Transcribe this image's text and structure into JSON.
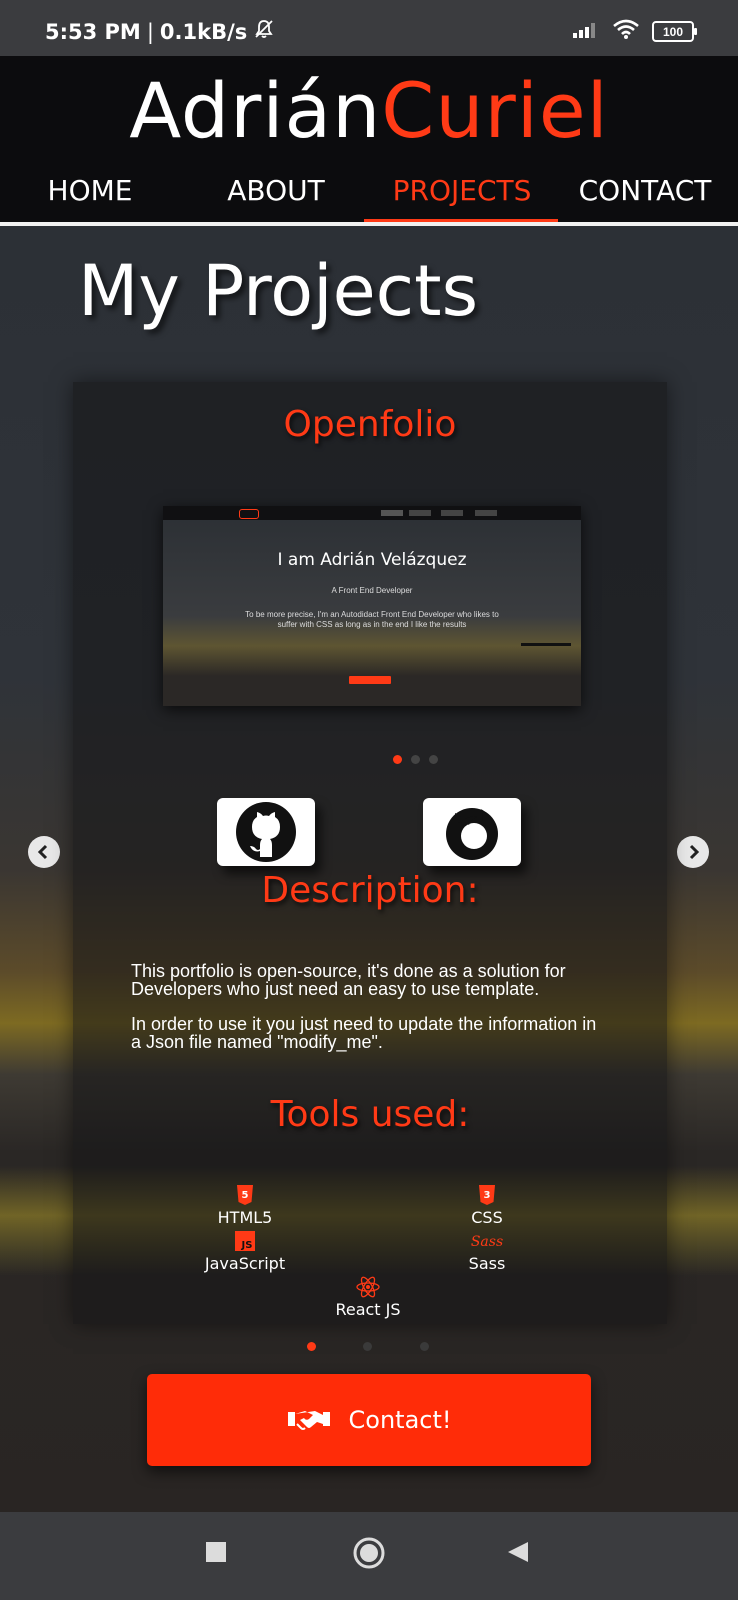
{
  "status_bar": {
    "time": "5:53 PM",
    "separator": "|",
    "net_speed": "0.1kB/s",
    "battery": "100",
    "icons": [
      "mute-bell-icon",
      "signal-icon",
      "wifi-icon",
      "battery-icon"
    ]
  },
  "header": {
    "brand_first": "Adrián",
    "brand_last": "Curiel",
    "nav": [
      {
        "label": "HOME",
        "active": false
      },
      {
        "label": "ABOUT",
        "active": false
      },
      {
        "label": "PROJECTS",
        "active": true
      },
      {
        "label": "CONTACT",
        "active": false
      }
    ]
  },
  "page": {
    "title": "My Projects"
  },
  "project": {
    "title": "Openfolio",
    "preview": {
      "heading": "I am Adrián Velázquez",
      "subheading": "A Front End Developer",
      "text": "To be more precise, I'm an Autodidact Front End Developer who likes to suffer with CSS as long as in the end I like the results"
    },
    "links": [
      "github-icon",
      "firefox-icon"
    ],
    "description_title": "Description:",
    "description": [
      "This portfolio is open-source, it's done as a solution for Developers who just need an easy to use template.",
      "In order to use it you just need to update the information in a Json file named \"modify_me\"."
    ],
    "tools_title": "Tools used:",
    "tools": [
      {
        "name": "HTML5",
        "icon": "html5-icon"
      },
      {
        "name": "CSS",
        "icon": "css3-icon"
      },
      {
        "name": "JavaScript",
        "icon": "javascript-icon"
      },
      {
        "name": "Sass",
        "icon": "sass-icon"
      },
      {
        "name": "React JS",
        "icon": "react-icon"
      }
    ]
  },
  "contact_button": {
    "label": "Contact!",
    "icon": "handshake-icon"
  },
  "colors": {
    "accent": "#ff3a16",
    "header_bg": "#0c0c0e",
    "button": "#ff2c08"
  }
}
